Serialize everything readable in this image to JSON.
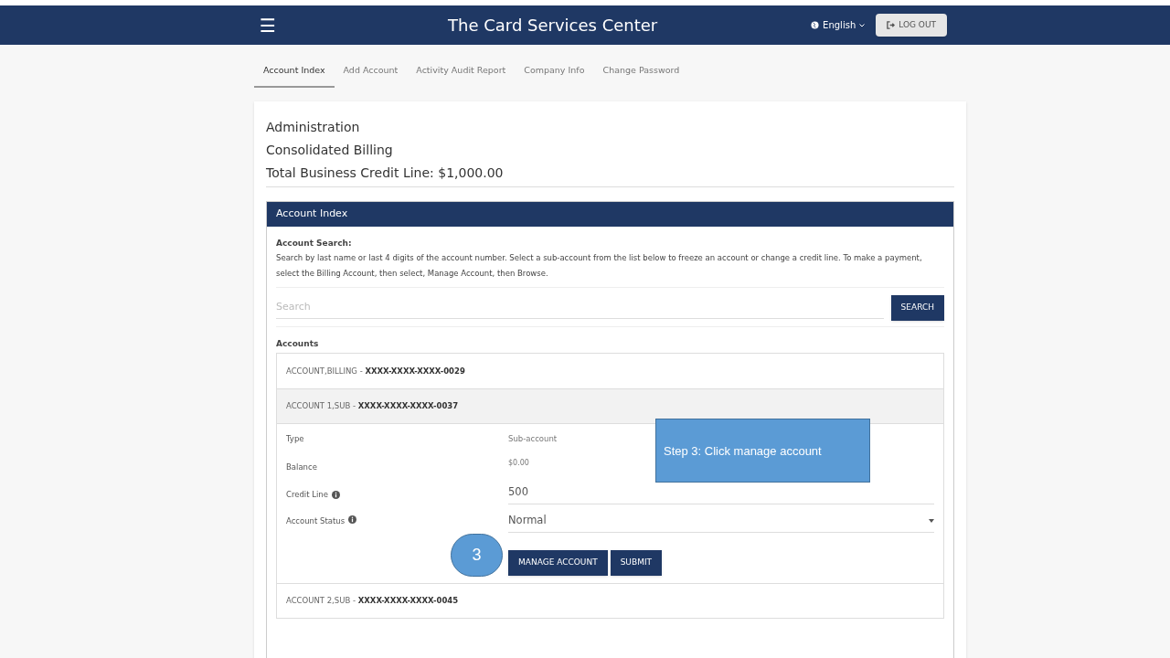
{
  "header": {
    "menu_icon": "☰",
    "title": "The Card Services Center",
    "language": "English",
    "logout": "LOG OUT"
  },
  "tabs": [
    {
      "label": "Account Index",
      "selected": true
    },
    {
      "label": "Add Account",
      "selected": false
    },
    {
      "label": "Activity Audit Report",
      "selected": false
    },
    {
      "label": "Company Info",
      "selected": false
    },
    {
      "label": "Change Password",
      "selected": false
    }
  ],
  "summary": [
    "Administration",
    "Consolidated Billing",
    "Total Business Credit Line: $1,000.00"
  ],
  "panel": {
    "title": "Account Index",
    "search_heading": "Account Search:",
    "search_help": "Search by last name or last 4 digits of the account number. Select a sub-account from the list below to freeze an account or change a credit line. To make a payment, select the Billing Account, then select, Manage Account, then Browse.",
    "search": {
      "placeholder": "Search",
      "button": "SEARCH"
    },
    "accounts_heading": "Accounts",
    "accounts": [
      {
        "name": "ACCOUNT,BILLING -",
        "number": "XXXX-XXXX-XXXX-0029",
        "expanded": false
      },
      {
        "name": "ACCOUNT 1,SUB -",
        "number": "XXXX-XXXX-XXXX-0037",
        "expanded": true,
        "details": {
          "type_label": "Type",
          "type": "Sub-account",
          "balance_label": "Balance",
          "balance": "$0.00",
          "credit_label": "Credit Line",
          "credit": "500",
          "status_label": "Account Status",
          "status": "Normal",
          "buttons": [
            "MANAGE ACCOUNT",
            "SUBMIT"
          ]
        }
      },
      {
        "name": "ACCOUNT 2,SUB -",
        "number": "XXXX-XXXX-XXXX-0045",
        "expanded": false
      }
    ]
  },
  "annotations": {
    "callout": "Step 3:  Click manage account",
    "step_marker": "3"
  }
}
